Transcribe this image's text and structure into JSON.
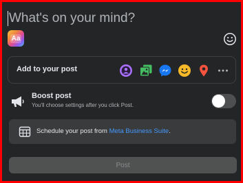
{
  "composer": {
    "placeholder": "What's on your mind?",
    "background_button_label": "Aa",
    "emoji_icon": "smiley-outline-icon"
  },
  "add_to_post": {
    "label": "Add to your post",
    "icons": [
      {
        "name": "tag-people-icon",
        "color": "#a970ff"
      },
      {
        "name": "photo-video-icon",
        "color": "#45bd62"
      },
      {
        "name": "messenger-icon",
        "color": "#1877f2"
      },
      {
        "name": "feeling-activity-icon",
        "color": "#f7b928"
      },
      {
        "name": "check-in-location-icon",
        "color": "#f5533d"
      },
      {
        "name": "more-options-icon",
        "color": "#b0b3b8"
      }
    ]
  },
  "boost": {
    "title": "Boost post",
    "subtitle": "You'll choose settings after you click Post.",
    "icon": "megaphone-icon",
    "toggle_on": false
  },
  "schedule": {
    "text_prefix": "Schedule your post from ",
    "link_text": "Meta Business Suite",
    "text_suffix": ".",
    "icon": "calendar-grid-icon"
  },
  "post_button": {
    "label": "Post",
    "enabled": false
  },
  "colors": {
    "background": "#242526",
    "border_highlight": "#ff0000",
    "link": "#4599ff",
    "button_disabled": "#505151"
  }
}
